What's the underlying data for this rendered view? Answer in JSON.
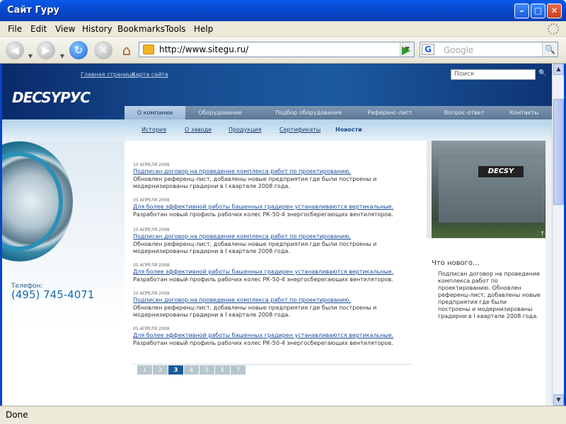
{
  "window": {
    "title": "Сайт Гуру"
  },
  "menu": [
    "File",
    "Edit",
    "View",
    "History",
    "Bookmarks",
    "Tools",
    "Help"
  ],
  "address": {
    "url": "http://www.sitegu.ru/"
  },
  "search_engine": {
    "placeholder": "Google"
  },
  "status": "Done",
  "site": {
    "top_links": [
      "Главная страница",
      "Карта сайта"
    ],
    "search_placeholder": "Поиск",
    "logo": "DECSYPУC",
    "nav_main": [
      "О компании",
      "Оборудование",
      "Подбор оборудования",
      "Референс-лист",
      "Вопрос-ответ",
      "Контакты"
    ],
    "nav_main_active": 0,
    "nav_sub": [
      "История",
      "О заводе",
      "Продукция",
      "Сертификаты",
      "Новости"
    ],
    "nav_sub_active": 4,
    "phone_label": "Телефон:",
    "phone": "(495) 745-4071",
    "photo_sign": "DECSY",
    "news": [
      {
        "date": "10 АПРЕЛЯ 2008",
        "title": "Подписан договор на проведение комплекса работ по проектированию.",
        "text": "Обновлен референц-лист, добавлены новые предприятия где были построены и модернизированы градирни в I квартале 2008 года."
      },
      {
        "date": "05 АПРЕЛЯ 2008",
        "title": "Для более эффективной работы башенных градирен устанавливаются вертикальные.",
        "text": "Разработан новый профиль рабочих колес РК-50-4 энергосберегающих вентиляторов."
      },
      {
        "date": "10 АПРЕЛЯ 2008",
        "title": "Подписан договор на проведение комплекса работ по проектированию.",
        "text": "Обновлен референц-лист, добавлены новые предприятия где были построены и модернизированы градирни в I квартале 2008 года."
      },
      {
        "date": "05 АПРЕЛЯ 2008",
        "title": "Для более эффективной работы башенных градирен устанавливаются вертикальные.",
        "text": "Разработан новый профиль рабочих колес РК-50-4 энергосберегающих вентиляторов."
      },
      {
        "date": "10 АПРЕЛЯ 2008",
        "title": "Подписан договор на проведение комплекса работ по проектированию.",
        "text": "Обновлен референц-лист, добавлены новые предприятия где были построены и модернизированы градирни в I квартале 2008 года."
      },
      {
        "date": "05 АПРЕЛЯ 2008",
        "title": "Для более эффективной работы башенных градирен устанавливаются вертикальные.",
        "text": "Разработан новый профиль рабочих колес РК-50-4 энергосберегающих вентиляторов."
      }
    ],
    "pages": [
      "1",
      "2",
      "3",
      "4",
      "5",
      "6",
      "7"
    ],
    "page_active": 2,
    "whats_new_title": "Что нового...",
    "whats_new_text": "Подписан договор на проведение комплекса работ по проектированию. Обновлен референц-лист, добавлены новые предприятия где были построены и модернизированы градирни в I квартале 2008 года."
  }
}
